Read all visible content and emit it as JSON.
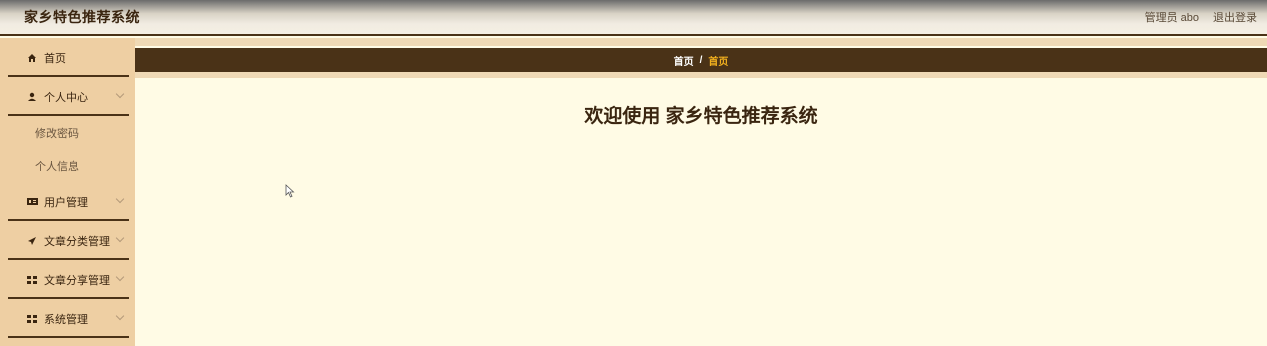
{
  "app": {
    "title": "家乡特色推荐系统"
  },
  "header": {
    "user_label": "管理员 abo",
    "logout_label": "退出登录"
  },
  "sidebar": {
    "home": {
      "label": "首页",
      "icon": "home-icon"
    },
    "personal_center": {
      "label": "个人中心",
      "icon": "user-icon",
      "children": [
        "修改密码",
        "个人信息"
      ]
    },
    "user_management": {
      "label": "用户管理",
      "icon": "users-icon"
    },
    "article_category_management": {
      "label": "文章分类管理",
      "icon": "send-icon"
    },
    "article_share_management": {
      "label": "文章分享管理",
      "icon": "grid-icon"
    },
    "system_management": {
      "label": "系统管理",
      "icon": "grid-icon"
    }
  },
  "breadcrumb": {
    "home": "首页",
    "separator": "/",
    "current": "首页"
  },
  "main": {
    "welcome": "欢迎使用 家乡特色推荐系统"
  },
  "colors": {
    "sidebar_bg": "#eecfa3",
    "accent_dark": "#4a3217",
    "breadcrumb_current": "#f2b01e",
    "content_bg": "#fffbe5"
  }
}
